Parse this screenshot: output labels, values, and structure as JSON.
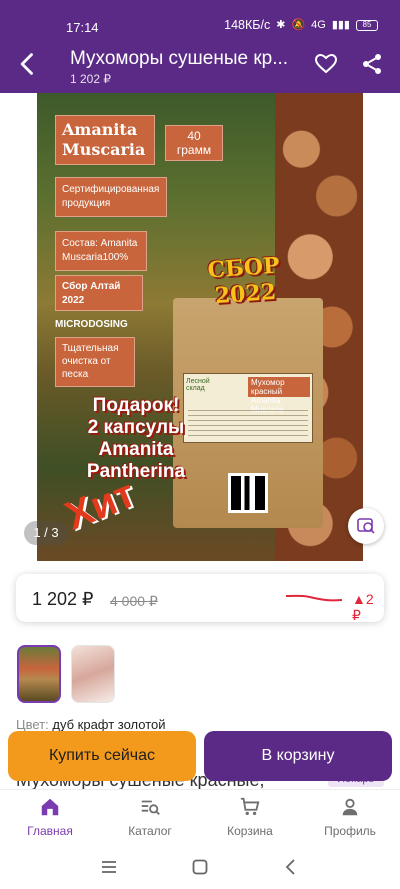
{
  "status_bar": {
    "time": "17:14",
    "network_speed": "148КБ/с",
    "signal": "4G",
    "battery": "85"
  },
  "app_bar": {
    "title": "Мухоморы сушеные кр...",
    "subtitle_price": "1 202 ₽"
  },
  "gallery": {
    "counter": "1 / 3",
    "image": {
      "name_line1": "Amanita",
      "name_line2": "Muscaria",
      "weight_value": "40",
      "weight_unit": "грамм",
      "certified": "Сертифицированная продукция",
      "composition": "Состав: Amanita Muscaria100%",
      "harvest": "Сбор Алтай 2022",
      "microdosing": "MICRODOSING",
      "cleaning": "Тщательная очистка от песка",
      "sbor_line1": "СБОР",
      "sbor_line2": "2022",
      "gift_line1": "Подарок!",
      "gift_line2": "2 капсулы",
      "gift_line3": "Amanita",
      "gift_line4": "Pantherina",
      "hit": "Хит",
      "bag_brand": "Лесной склад",
      "bag_label_name": "Мухомор красный Amanita Muscaria",
      "bag_label_weight": "40 грамм"
    }
  },
  "price_card": {
    "price": "1 202 ₽",
    "old_price": "4 000 ₽",
    "delta": "▲2 ₽",
    "delta_color": "#e0263a"
  },
  "variant": {
    "label": "Цвет:",
    "value": "дуб крафт золотой"
  },
  "product": {
    "name": "Мухоморы сушеные красные,",
    "brand_badge": "Лекарь"
  },
  "actions": {
    "buy_now": "Купить сейчас",
    "add_to_cart": "В корзину",
    "buy_color": "#f39a1c",
    "cart_color": "#5b2a86"
  },
  "bottom_nav": {
    "items": [
      {
        "label": "Главная",
        "icon": "home-icon",
        "active": true
      },
      {
        "label": "Каталог",
        "icon": "catalog-icon",
        "active": false
      },
      {
        "label": "Корзина",
        "icon": "cart-icon",
        "active": false
      },
      {
        "label": "Профиль",
        "icon": "profile-icon",
        "active": false
      }
    ]
  },
  "system_nav": {
    "menu_icon": "menu-icon",
    "home_icon": "square-icon",
    "back_icon": "back-triangle-icon"
  },
  "theme": {
    "primary": "#5b2a86",
    "accent": "#7b3bb0"
  }
}
